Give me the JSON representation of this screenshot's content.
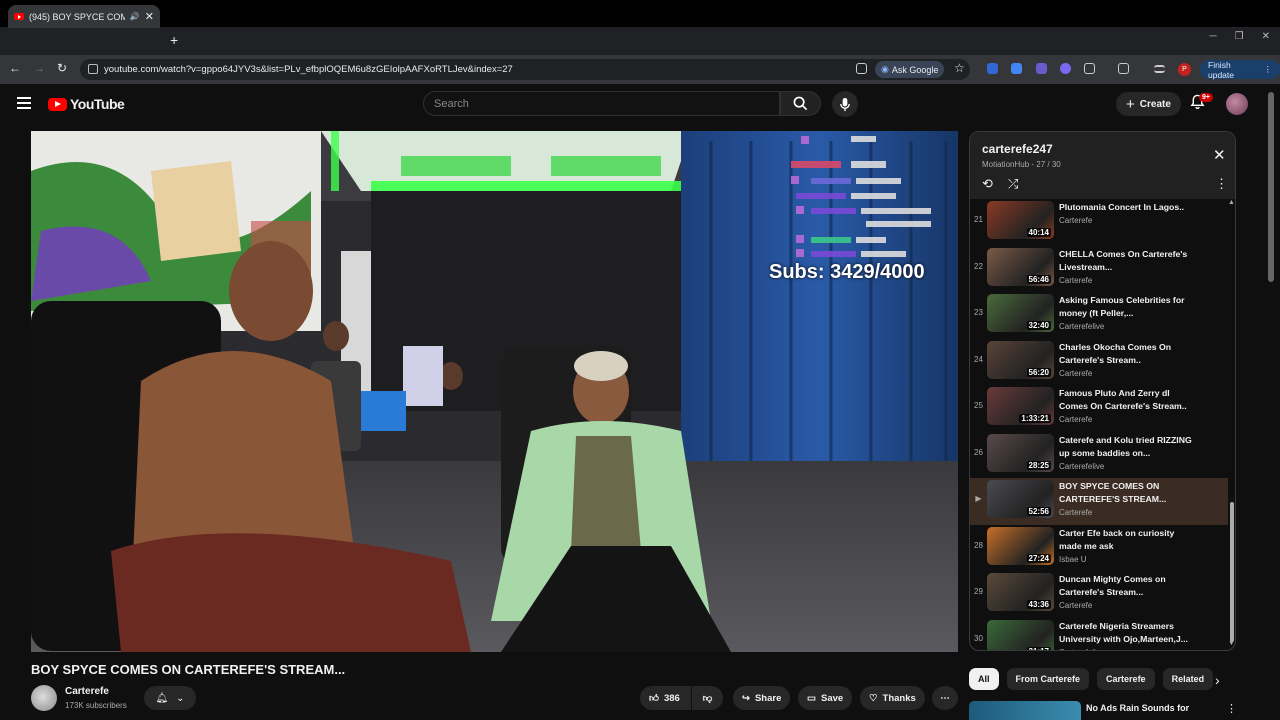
{
  "browser": {
    "tab_title": "(945) BOY SPYCE COMES O",
    "url": "youtube.com/watch?v=gppo64JYV3s&list=PLv_efbplOQEM6u8zGEIolpAAFXoRTLJev&index=27",
    "ask_google": "Ask Google",
    "finish_update": "Finish update",
    "profile_initial": "P"
  },
  "header": {
    "logo_text": "YouTube",
    "search_placeholder": "Search",
    "create_label": "Create",
    "notif_badge": "9+"
  },
  "video": {
    "title": "BOY SPYCE COMES ON CARTEREFE'S STREAM...",
    "channel": "Carterefe",
    "subscribers": "173K subscribers",
    "likes": "386",
    "share_label": "Share",
    "save_label": "Save",
    "thanks_label": "Thanks",
    "overlay_subs": "Subs: 3429/4000"
  },
  "playlist": {
    "title": "carterefe247",
    "subtitle": "MotiationHub - 27 / 30",
    "items": [
      {
        "index": "21",
        "title": "Plutomania Concert In Lagos..",
        "channel": "Carterefe",
        "duration": "40:14",
        "color": "#8a3a24"
      },
      {
        "index": "22",
        "title": "CHELLA Comes On Carterefe's Livestream...",
        "channel": "Carterefe",
        "duration": "56:46",
        "color": "#7a5a48"
      },
      {
        "index": "23",
        "title": "Asking Famous Celebrities for money (ft Peller,...",
        "channel": "Carterefelive",
        "duration": "32:40",
        "color": "#4a6a3a"
      },
      {
        "index": "24",
        "title": "Charles Okocha Comes On Carterefe's Stream..",
        "channel": "Carterefe",
        "duration": "56:20",
        "color": "#5a4438"
      },
      {
        "index": "25",
        "title": "Famous Pluto And Zerry dl Comes On Carterefe's Stream..",
        "channel": "Carterefe",
        "duration": "1:33:21",
        "color": "#6a3a3a"
      },
      {
        "index": "26",
        "title": "Caterefe and Kolu tried RIZZING up some baddies on...",
        "channel": "Carterefelive",
        "duration": "28:25",
        "color": "#5a4a4a"
      },
      {
        "index": "▶",
        "title": "BOY SPYCE COMES ON CARTEREFE'S STREAM...",
        "channel": "Carterefe",
        "duration": "52:56",
        "color": "#4a4a52"
      },
      {
        "index": "28",
        "title": "Carter Efe back on curiosity made me ask",
        "channel": "Isbae U",
        "duration": "27:24",
        "color": "#c8702a"
      },
      {
        "index": "29",
        "title": "Duncan Mighty Comes on Carterefe's Stream...",
        "channel": "Carterefe",
        "duration": "43:36",
        "color": "#5a4a3a"
      },
      {
        "index": "30",
        "title": "Carterefe Nigeria Streamers University with Ojo,Marteen,J...",
        "channel": "Carterefelive",
        "duration": "31:17",
        "color": "#3a6a3a"
      }
    ]
  },
  "chips": [
    "All",
    "From Carterefe",
    "Carterefe",
    "Related"
  ],
  "next_video": {
    "title": "No Ads Rain Sounds for"
  }
}
